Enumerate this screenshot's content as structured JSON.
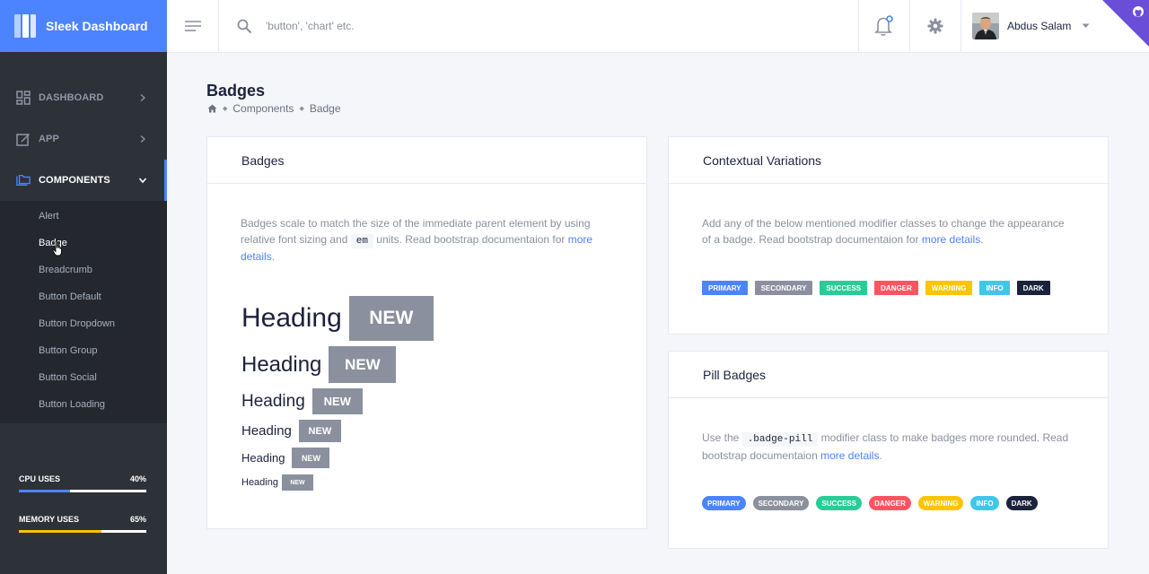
{
  "app": {
    "title": "Sleek Dashboard",
    "brand_color": "#4c84ff"
  },
  "sidebar": {
    "items": [
      {
        "label": "DASHBOARD",
        "icon": "dashboard-icon"
      },
      {
        "label": "APP",
        "icon": "pencil-square-icon"
      },
      {
        "label": "COMPONENTS",
        "icon": "folders-icon"
      }
    ],
    "components_sub": [
      "Alert",
      "Badge",
      "Breadcrumb",
      "Button Default",
      "Button Dropdown",
      "Button Group",
      "Button Social",
      "Button Loading"
    ],
    "stats": [
      {
        "label": "CPU USES",
        "value": "40%",
        "fraction": 0.4,
        "color": "#4c84ff"
      },
      {
        "label": "MEMORY USES",
        "value": "65%",
        "fraction": 0.65,
        "color": "#fec400"
      }
    ]
  },
  "header": {
    "search_placeholder": "'button', 'chart' etc.",
    "user_name": "Abdus Salam"
  },
  "page": {
    "title": "Badges",
    "breadcrumb": [
      "Components",
      "Badge"
    ]
  },
  "card_badges": {
    "title": "Badges",
    "desc_1": "Badges scale to match the size of the immediate parent element by using relative font sizing and ",
    "desc_code": "em",
    "desc_2": " units. Read bootstrap documentaion for ",
    "link": "more details",
    "desc_end": ".",
    "heading_text": "Heading",
    "badge_text": "NEW"
  },
  "card_contextual": {
    "title": "Contextual Variations",
    "desc": "Add any of the below mentioned modifier classes to change the appearance of a badge. Read bootstrap documentaion for ",
    "link": "more details",
    "desc_end": ".",
    "badges": [
      {
        "label": "PRIMARY",
        "color": "#4c84ff"
      },
      {
        "label": "SECONDARY",
        "color": "#8a909d"
      },
      {
        "label": "SUCCESS",
        "color": "#29cc97"
      },
      {
        "label": "DANGER",
        "color": "#fe5461"
      },
      {
        "label": "WARNING",
        "color": "#fec400"
      },
      {
        "label": "INFO",
        "color": "#41c6ea"
      },
      {
        "label": "DARK",
        "color": "#1b223c"
      }
    ]
  },
  "card_pill": {
    "title": "Pill Badges",
    "desc_1": "Use the ",
    "desc_code": ".badge-pill",
    "desc_2": " modifier class to make badges more rounded. Read bootstrap documentaion ",
    "link": "more details",
    "desc_end": "."
  }
}
